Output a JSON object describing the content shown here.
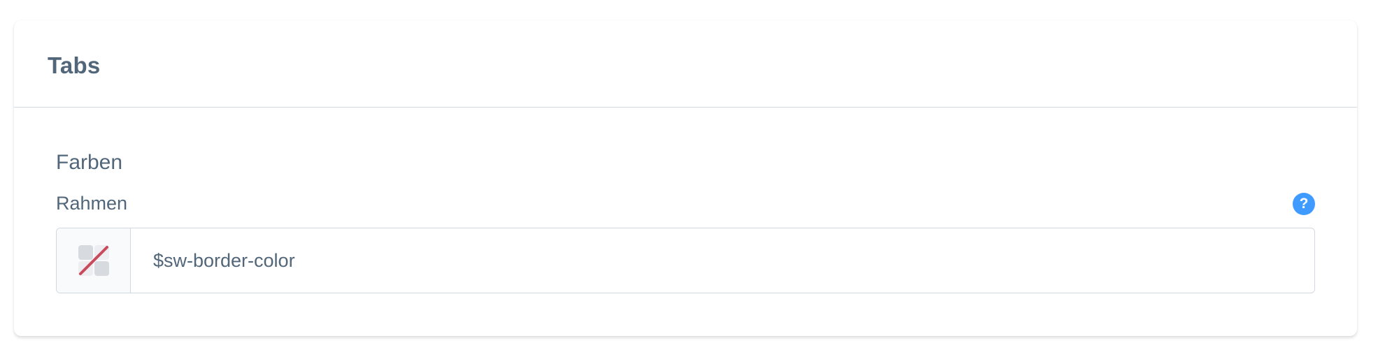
{
  "card": {
    "title": "Tabs"
  },
  "section": {
    "title": "Farben"
  },
  "field": {
    "label": "Rahmen",
    "value": "$sw-border-color",
    "help_icon": "question-icon",
    "help_glyph": "?",
    "swatch_icon": "transparent-color-icon"
  },
  "colors": {
    "text": "#52667a",
    "help_icon_bg": "#3f9bff",
    "border": "#d1d9e0",
    "swatch_strike": "#c94a5c"
  }
}
